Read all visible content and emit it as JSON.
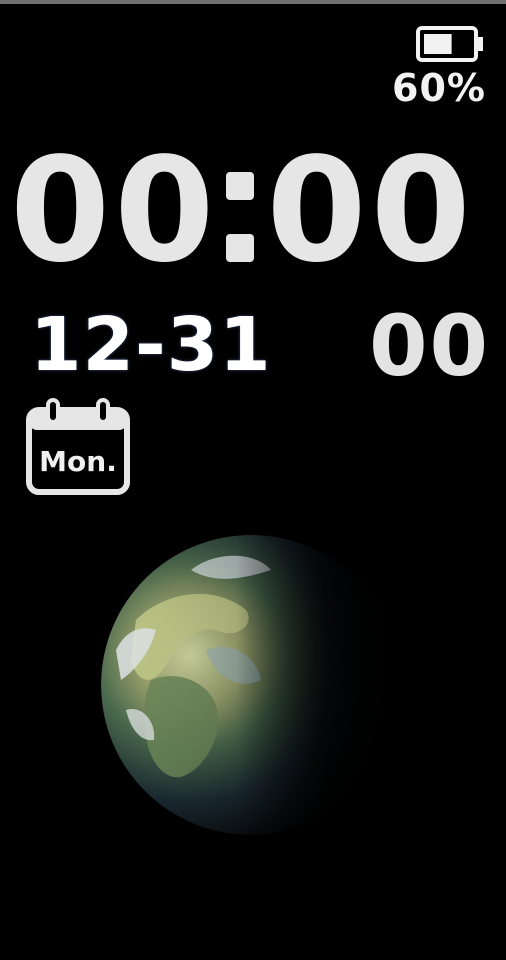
{
  "status": {
    "battery_percent_label": "60%",
    "battery_level": 0.6
  },
  "clock": {
    "hours": "00",
    "minutes": "00",
    "date": "12-31",
    "seconds": "00",
    "weekday": "Mon."
  },
  "icons": {
    "battery": "battery-icon",
    "calendar": "calendar-icon",
    "earth": "earth-icon"
  },
  "colors": {
    "background": "#000000",
    "text_primary": "#e6e6e6"
  }
}
